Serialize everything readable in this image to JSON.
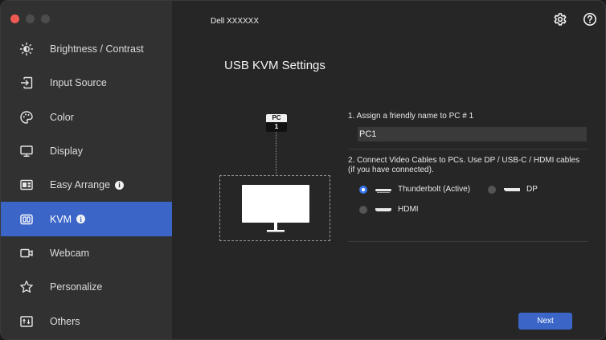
{
  "window": {
    "monitor_name": "Dell XXXXXX"
  },
  "sidebar": {
    "items": [
      {
        "label": "Brightness / Contrast",
        "icon": "sun-icon"
      },
      {
        "label": "Input Source",
        "icon": "input-icon"
      },
      {
        "label": "Color",
        "icon": "palette-icon"
      },
      {
        "label": "Display",
        "icon": "monitor-icon"
      },
      {
        "label": "Easy Arrange",
        "icon": "layout-icon",
        "info": "i"
      },
      {
        "label": "KVM",
        "icon": "kvm-icon",
        "info": "i",
        "active": true
      },
      {
        "label": "Webcam",
        "icon": "webcam-icon"
      },
      {
        "label": "Personalize",
        "icon": "star-icon"
      },
      {
        "label": "Others",
        "icon": "others-icon"
      }
    ]
  },
  "header": {
    "settings_icon": "gear-icon",
    "help_icon": "help-icon"
  },
  "main": {
    "title": "USB KVM Settings",
    "diagram": {
      "pc_label": "PC",
      "pc_number": "1"
    },
    "step1": {
      "label": "1. Assign a friendly name to PC # 1",
      "value": "PC1"
    },
    "step2": {
      "label": "2. Connect Video Cables to PCs. Use DP / USB-C / HDMI cables (if you have connected)."
    },
    "options": [
      {
        "label": "Thunderbolt (Active)",
        "icon": "thunderbolt-port-icon",
        "selected": true
      },
      {
        "label": "DP",
        "icon": "dp-port-icon",
        "selected": false
      },
      {
        "label": "HDMI",
        "icon": "hdmi-port-icon",
        "selected": false
      }
    ],
    "next_label": "Next"
  },
  "colors": {
    "accent": "#3b66c8",
    "radio_selected": "#3b78f0",
    "background": "#262626",
    "sidebar": "#313131"
  }
}
